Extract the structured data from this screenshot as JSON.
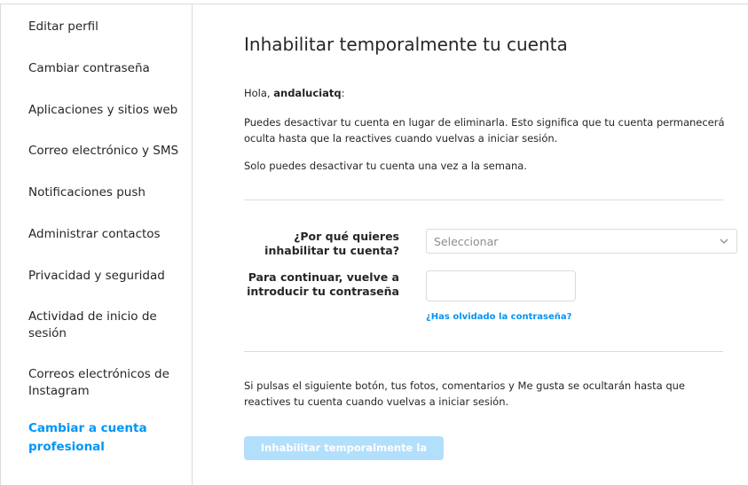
{
  "sidebar": {
    "items": [
      {
        "label": "Editar perfil"
      },
      {
        "label": "Cambiar contraseña"
      },
      {
        "label": "Aplicaciones y sitios web"
      },
      {
        "label": "Correo electrónico y SMS"
      },
      {
        "label": "Notificaciones push"
      },
      {
        "label": "Administrar contactos"
      },
      {
        "label": "Privacidad y seguridad"
      },
      {
        "label": "Actividad de inicio de sesión"
      },
      {
        "label": "Correos electrónicos de Instagram"
      },
      {
        "label": "Cambiar a cuenta profesional"
      }
    ]
  },
  "main": {
    "title": "Inhabilitar temporalmente tu cuenta",
    "greeting_prefix": "Hola, ",
    "username": "andaluciatq",
    "greeting_suffix": ":",
    "description": "Puedes desactivar tu cuenta en lugar de eliminarla. Esto significa que tu cuenta permanecerá oculta hasta que la reactives cuando vuelvas a iniciar sesión.",
    "limit_note": "Solo puedes desactivar tu cuenta una vez a la semana.",
    "reason_label": "¿Por qué quieres inhabilitar tu cuenta?",
    "reason_placeholder": "Seleccionar",
    "password_label": "Para continuar, vuelve a introducir tu contraseña",
    "password_value": "",
    "forgot_password": "¿Has olvidado la contraseña?",
    "warning": "Si pulsas el siguiente botón, tus fotos, comentarios y Me gusta se ocultarán hasta que reactives tu cuenta cuando vuelvas a iniciar sesión.",
    "submit_label": "Inhabilitar temporalmente la cuenta"
  },
  "colors": {
    "accent": "#0095f6",
    "button_disabled": "#b2dffc",
    "border": "#dbdbdb",
    "text": "#262626",
    "placeholder": "#8e8e8e"
  },
  "icons": {
    "select_arrow": "chevron-down-icon"
  }
}
